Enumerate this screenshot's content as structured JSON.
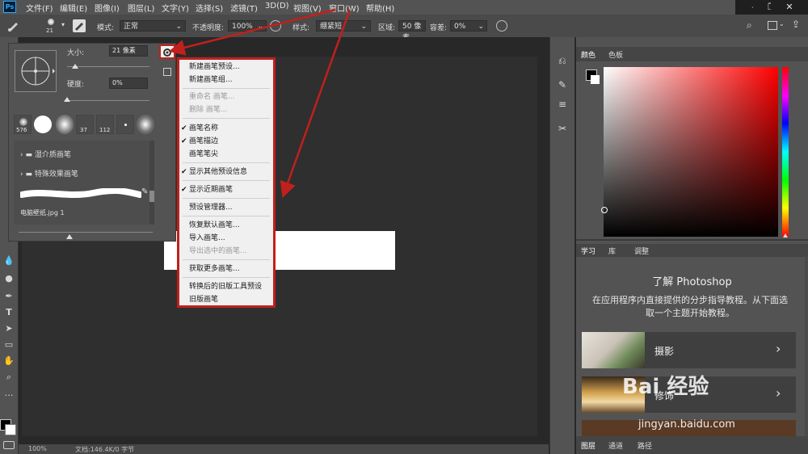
{
  "menubar": {
    "logo": "Ps",
    "items": [
      "文件(F)",
      "编辑(E)",
      "图像(I)",
      "图层(L)",
      "文字(Y)",
      "选择(S)",
      "滤镜(T)",
      "3D(D)",
      "视图(V)",
      "窗口(W)",
      "帮助(H)"
    ],
    "window_controls": {
      "minimize": "–",
      "restore": "❐",
      "close": "✕"
    }
  },
  "options": {
    "brush_size": "21",
    "mode_label": "模式:",
    "mode_value": "正常",
    "opacity_label": "不透明度:",
    "opacity_value": "100%",
    "style_label": "样式:",
    "style_value": "绷紧短",
    "area_label": "区域:",
    "area_value": "50 像素",
    "tolerance_label": "容差:",
    "tolerance_value": "0%"
  },
  "brush_panel": {
    "size_label": "大小:",
    "size_value": "21 像素",
    "hardness_label": "硬度:",
    "hardness_value": "0%",
    "presets": [
      "576",
      "",
      "37",
      "112",
      "",
      ""
    ],
    "folders": [
      "湿介质画笔",
      "特殊效果画笔"
    ],
    "stroke_name": "电脑壁纸.jpg 1"
  },
  "dropdown": {
    "items": [
      {
        "label": "新建画笔预设...",
        "checked": false,
        "disabled": false
      },
      {
        "label": "新建画笔组...",
        "checked": false,
        "disabled": false
      },
      {
        "label": "重命名 画笔...",
        "checked": false,
        "disabled": true
      },
      {
        "label": "删除 画笔...",
        "checked": false,
        "disabled": true
      },
      {
        "label": "画笔名称",
        "checked": true,
        "disabled": false
      },
      {
        "label": "画笔描边",
        "checked": true,
        "disabled": false
      },
      {
        "label": "画笔笔尖",
        "checked": false,
        "disabled": false
      },
      {
        "label": "显示其他预设信息",
        "checked": true,
        "disabled": false
      },
      {
        "label": "显示近期画笔",
        "checked": true,
        "disabled": false
      },
      {
        "label": "预设管理器...",
        "checked": false,
        "disabled": false
      },
      {
        "label": "恢复默认画笔...",
        "checked": false,
        "disabled": false
      },
      {
        "label": "导入画笔...",
        "checked": false,
        "disabled": false
      },
      {
        "label": "导出选中的画笔...",
        "checked": false,
        "disabled": true
      },
      {
        "label": "获取更多画笔...",
        "checked": false,
        "disabled": false
      },
      {
        "label": "转换后的旧版工具预设",
        "checked": false,
        "disabled": false
      },
      {
        "label": "旧版画笔",
        "checked": false,
        "disabled": false
      }
    ]
  },
  "color_panel": {
    "tab_color": "颜色",
    "tab_swatches": "色板"
  },
  "learn_panel": {
    "tabs": [
      "学习",
      "库",
      "调整"
    ],
    "title": "了解 Photoshop",
    "description": "在应用程序内直接提供的分步指导教程。从下面选取一个主题开始教程。",
    "cards": [
      "摄影",
      "修饰"
    ]
  },
  "layers_tabs": [
    "图层",
    "通道",
    "路径"
  ],
  "status": {
    "zoom": "100%",
    "doc": "文档:146.4K/0 字节"
  },
  "watermark": {
    "text": "Bai 经验",
    "url": "jingyan.baidu.com"
  },
  "colors": {
    "highlight": "#c1201c"
  }
}
